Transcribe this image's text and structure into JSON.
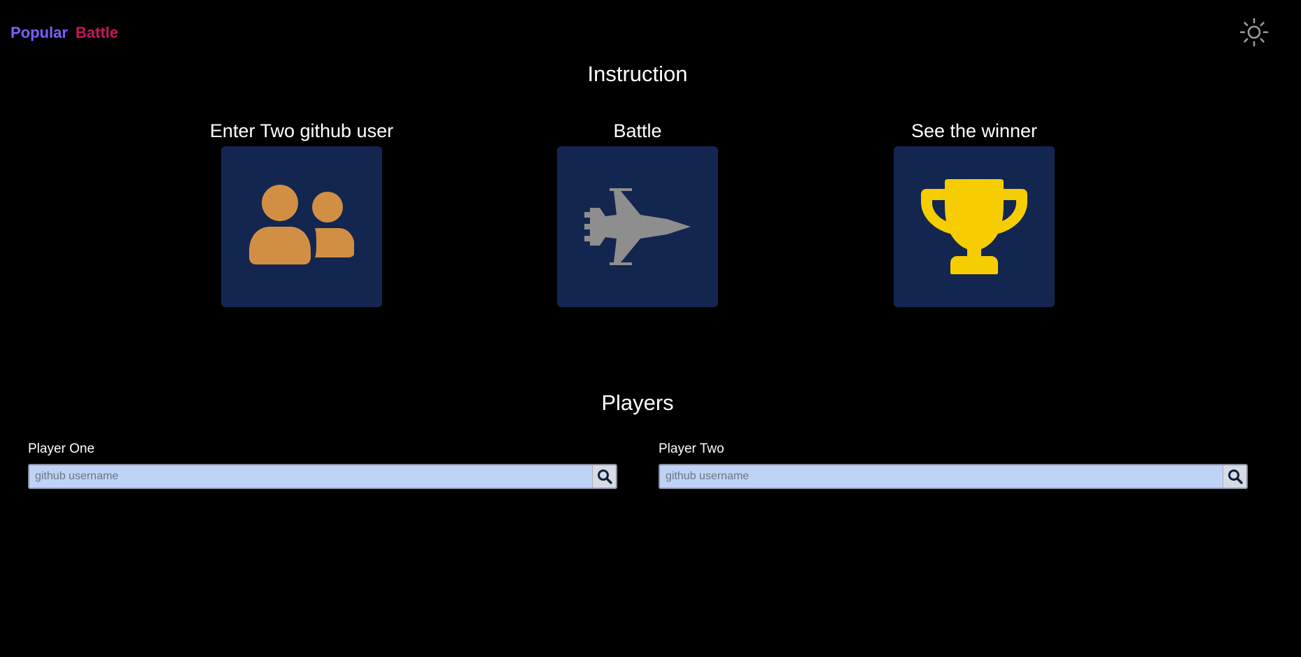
{
  "nav": {
    "popular_label": "Popular",
    "battle_label": "Battle",
    "popular_color": "#7b61ff",
    "battle_color": "#c2185b"
  },
  "theme_toggle": {
    "icon": "sun-icon"
  },
  "instruction": {
    "title": "Instruction",
    "steps": [
      {
        "label": "Enter Two github user",
        "icon": "users-icon",
        "icon_color": "#d18f43"
      },
      {
        "label": "Battle",
        "icon": "fighter-jet-icon",
        "icon_color": "#8e8e8e"
      },
      {
        "label": "See the winner",
        "icon": "trophy-icon",
        "icon_color": "#f6cd00"
      }
    ],
    "card_color": "#12264f"
  },
  "players": {
    "title": "Players",
    "player_one": {
      "label": "Player One",
      "placeholder": "github username",
      "value": ""
    },
    "player_two": {
      "label": "Player Two",
      "placeholder": "github username",
      "value": ""
    }
  }
}
